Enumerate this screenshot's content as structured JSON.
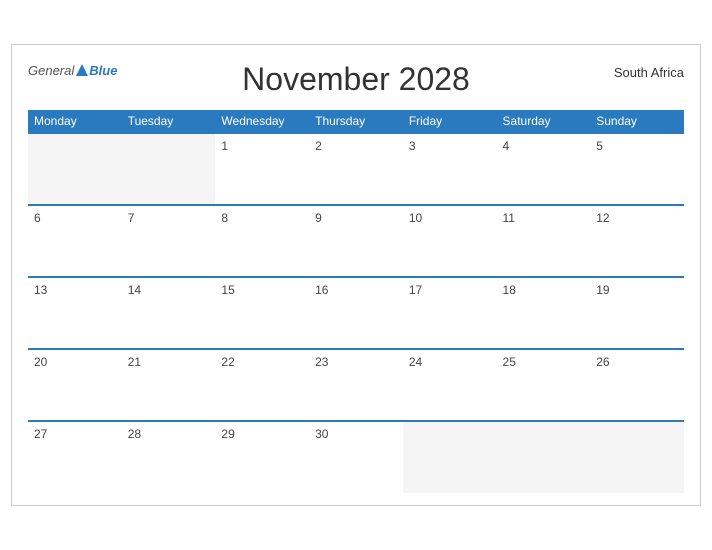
{
  "header": {
    "title": "November 2028",
    "country": "South Africa",
    "logo_general": "General",
    "logo_blue": "Blue"
  },
  "weekdays": [
    "Monday",
    "Tuesday",
    "Wednesday",
    "Thursday",
    "Friday",
    "Saturday",
    "Sunday"
  ],
  "weeks": [
    [
      {
        "day": "",
        "empty": true
      },
      {
        "day": "",
        "empty": true
      },
      {
        "day": "1",
        "empty": false
      },
      {
        "day": "2",
        "empty": false
      },
      {
        "day": "3",
        "empty": false
      },
      {
        "day": "4",
        "empty": false
      },
      {
        "day": "5",
        "empty": false
      }
    ],
    [
      {
        "day": "6",
        "empty": false
      },
      {
        "day": "7",
        "empty": false
      },
      {
        "day": "8",
        "empty": false
      },
      {
        "day": "9",
        "empty": false
      },
      {
        "day": "10",
        "empty": false
      },
      {
        "day": "11",
        "empty": false
      },
      {
        "day": "12",
        "empty": false
      }
    ],
    [
      {
        "day": "13",
        "empty": false
      },
      {
        "day": "14",
        "empty": false
      },
      {
        "day": "15",
        "empty": false
      },
      {
        "day": "16",
        "empty": false
      },
      {
        "day": "17",
        "empty": false
      },
      {
        "day": "18",
        "empty": false
      },
      {
        "day": "19",
        "empty": false
      }
    ],
    [
      {
        "day": "20",
        "empty": false
      },
      {
        "day": "21",
        "empty": false
      },
      {
        "day": "22",
        "empty": false
      },
      {
        "day": "23",
        "empty": false
      },
      {
        "day": "24",
        "empty": false
      },
      {
        "day": "25",
        "empty": false
      },
      {
        "day": "26",
        "empty": false
      }
    ],
    [
      {
        "day": "27",
        "empty": false
      },
      {
        "day": "28",
        "empty": false
      },
      {
        "day": "29",
        "empty": false
      },
      {
        "day": "30",
        "empty": false
      },
      {
        "day": "",
        "empty": true
      },
      {
        "day": "",
        "empty": true
      },
      {
        "day": "",
        "empty": true
      }
    ]
  ]
}
